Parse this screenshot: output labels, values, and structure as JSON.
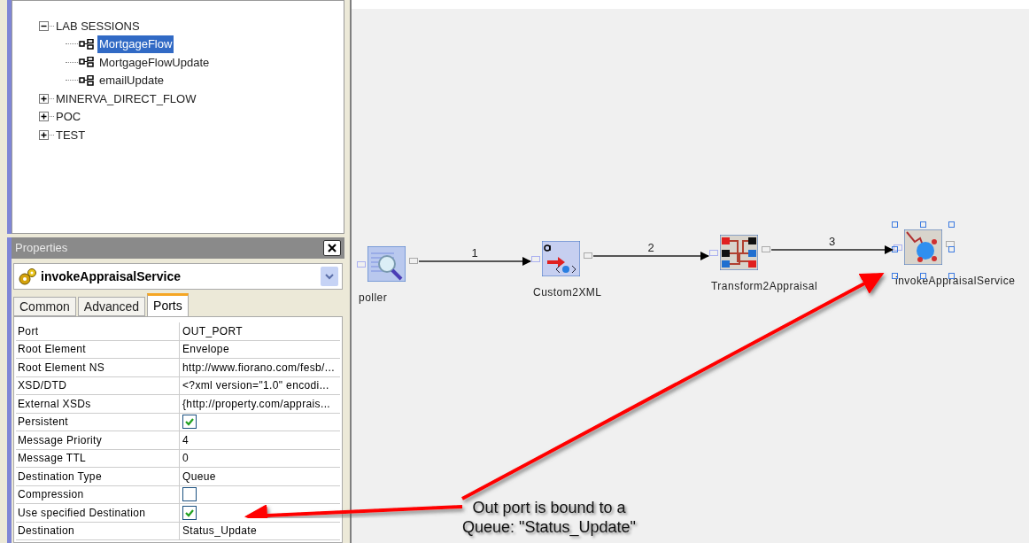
{
  "tree": [
    {
      "label": "LAB SESSIONS",
      "expanded": true,
      "selected": false,
      "children": [
        {
          "label": "MortgageFlow",
          "selected": true
        },
        {
          "label": "MortgageFlowUpdate",
          "selected": false
        },
        {
          "label": "emailUpdate",
          "selected": false
        }
      ]
    },
    {
      "label": "MINERVA_DIRECT_FLOW",
      "expanded": false,
      "selected": false
    },
    {
      "label": "POC",
      "expanded": false,
      "selected": false
    },
    {
      "label": "TEST",
      "expanded": false,
      "selected": false
    }
  ],
  "properties": {
    "title": "Properties",
    "component": "invokeAppraisalService",
    "tabs": [
      {
        "label": "Common",
        "selected": false
      },
      {
        "label": "Advanced",
        "selected": false
      },
      {
        "label": "Ports",
        "selected": true
      }
    ],
    "rows": [
      {
        "name": "Port",
        "kind": "text",
        "value": "OUT_PORT"
      },
      {
        "name": "Root Element",
        "kind": "text",
        "value": "Envelope"
      },
      {
        "name": "Root Element NS",
        "kind": "text",
        "value": "http://www.fiorano.com/fesb/..."
      },
      {
        "name": "XSD/DTD",
        "kind": "text",
        "value": "<?xml version=\"1.0\" encodi..."
      },
      {
        "name": "External XSDs",
        "kind": "text",
        "value": "{http://property.com/apprais..."
      },
      {
        "name": "Persistent",
        "kind": "checkbox",
        "checked": true
      },
      {
        "name": "Message Priority",
        "kind": "text",
        "value": "4"
      },
      {
        "name": "Message TTL",
        "kind": "text",
        "value": "0"
      },
      {
        "name": "Destination Type",
        "kind": "text",
        "value": "Queue"
      },
      {
        "name": "Compression",
        "kind": "checkbox",
        "checked": false
      },
      {
        "name": "Use specified Destination",
        "kind": "checkbox",
        "checked": true
      },
      {
        "name": "Destination",
        "kind": "text",
        "value": "Status_Update"
      }
    ]
  },
  "flow": {
    "nodes": [
      {
        "label": "poller",
        "kind": "poller",
        "selected": false
      },
      {
        "label": "Custom2XML",
        "kind": "xml",
        "selected": false
      },
      {
        "label": "Transform2Appraisal",
        "kind": "transform",
        "selected": false
      },
      {
        "label": "invokeAppraisalService",
        "kind": "service",
        "selected": true
      }
    ],
    "edges": [
      {
        "label": "1"
      },
      {
        "label": "2"
      },
      {
        "label": "3"
      }
    ]
  },
  "annotation": {
    "lines": [
      "Out port is bound to a",
      "Queue: \"Status_Update\""
    ]
  }
}
